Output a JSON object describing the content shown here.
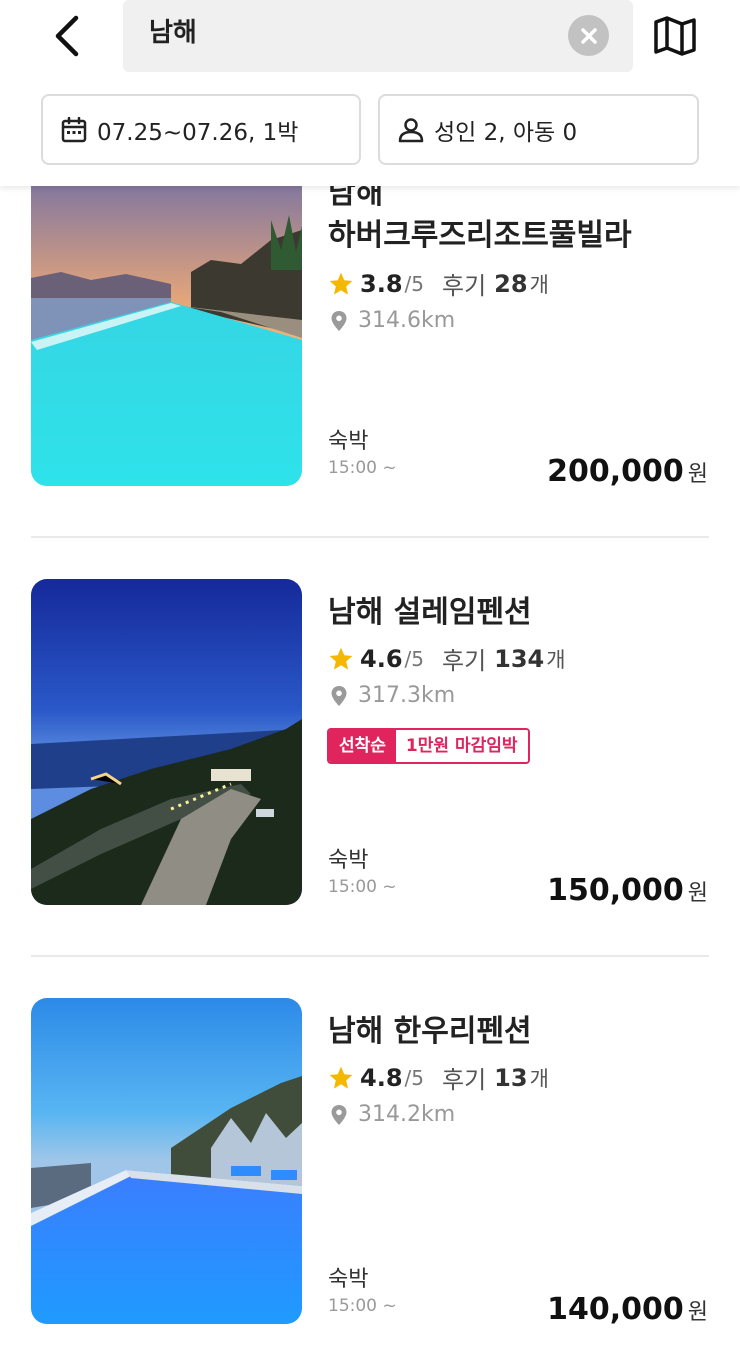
{
  "search": {
    "query": "남해"
  },
  "filters": {
    "date": "07.25~07.26, 1박",
    "guests": "성인 2, 아동 0"
  },
  "listings": [
    {
      "name_line1": "남해",
      "name_line2": "하버크루즈리조트풀빌라",
      "rating": "3.8",
      "rating_max": "/5",
      "review_label": "후기",
      "review_count": "28",
      "review_unit": "개",
      "distance": "314.6km",
      "stay_type": "숙박",
      "checkin": "15:00 ~",
      "price": "200,000",
      "currency": "원"
    },
    {
      "name": "남해 설레임펜션",
      "rating": "4.6",
      "rating_max": "/5",
      "review_label": "후기",
      "review_count": "134",
      "review_unit": "개",
      "distance": "317.3km",
      "promo_tag": "선착순",
      "promo_text": "1만원 마감임박",
      "stay_type": "숙박",
      "checkin": "15:00 ~",
      "price": "150,000",
      "currency": "원"
    },
    {
      "name": "남해 한우리펜션",
      "rating": "4.8",
      "rating_max": "/5",
      "review_label": "후기",
      "review_count": "13",
      "review_unit": "개",
      "distance": "314.2km",
      "stay_type": "숙박",
      "checkin": "15:00 ~",
      "price": "140,000",
      "currency": "원"
    }
  ],
  "icons": {
    "back": "chevron-left-icon",
    "clear": "close-icon",
    "map": "map-icon",
    "calendar": "calendar-icon",
    "guests": "person-icon",
    "star": "star-icon",
    "location": "location-pin-icon"
  },
  "colors": {
    "star": "#f5b800",
    "promo": "#e0245e",
    "search_bg": "#f0f0f0"
  }
}
